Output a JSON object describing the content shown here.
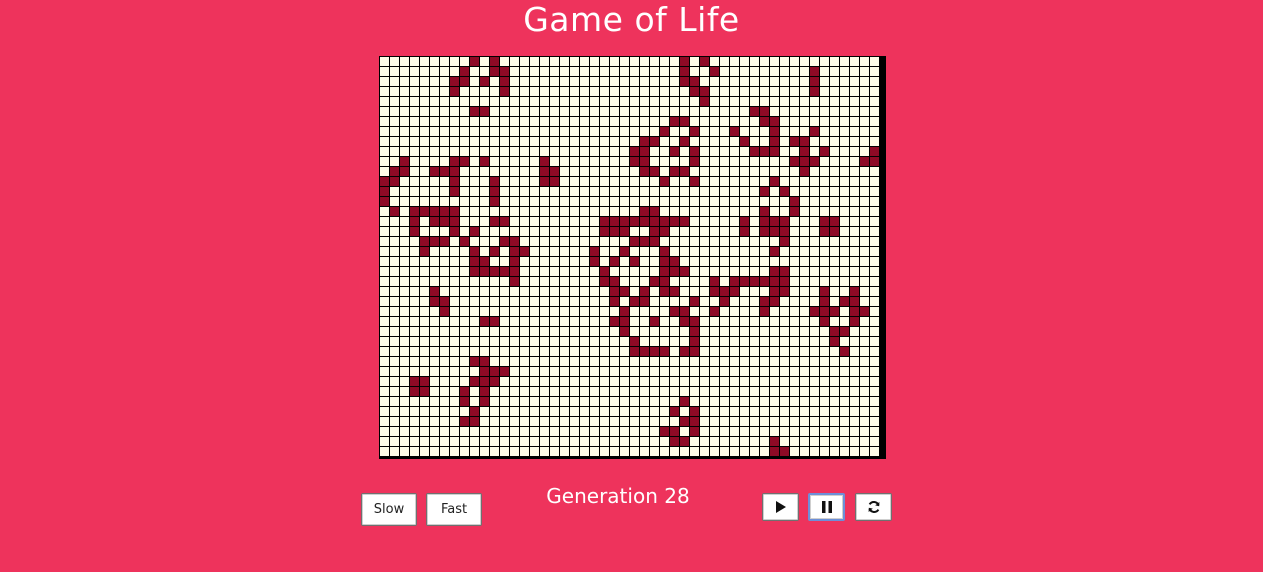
{
  "title": "Game of Life",
  "generation_label": "Generation 28",
  "controls": {
    "slow_label": "Slow",
    "fast_label": "Fast",
    "play_icon": "play-icon",
    "pause_icon": "pause-icon",
    "reset_icon": "refresh-icon"
  },
  "colors": {
    "background": "#ee335c",
    "cell_alive": "#8e0a25",
    "cell_dead": "#fffee8",
    "grid_line": "#000000"
  },
  "board": {
    "cols": 50,
    "rows": 40,
    "generation": 28,
    "live_cells": [
      [
        0,
        9
      ],
      [
        0,
        11
      ],
      [
        0,
        30
      ],
      [
        0,
        32
      ],
      [
        1,
        8
      ],
      [
        1,
        11
      ],
      [
        1,
        12
      ],
      [
        1,
        30
      ],
      [
        1,
        33
      ],
      [
        1,
        43
      ],
      [
        2,
        7
      ],
      [
        2,
        8
      ],
      [
        2,
        10
      ],
      [
        2,
        12
      ],
      [
        2,
        30
      ],
      [
        2,
        31
      ],
      [
        2,
        43
      ],
      [
        3,
        7
      ],
      [
        3,
        12
      ],
      [
        3,
        31
      ],
      [
        3,
        32
      ],
      [
        3,
        43
      ],
      [
        4,
        32
      ],
      [
        5,
        9
      ],
      [
        5,
        10
      ],
      [
        5,
        37
      ],
      [
        5,
        38
      ],
      [
        6,
        29
      ],
      [
        6,
        30
      ],
      [
        6,
        38
      ],
      [
        6,
        39
      ],
      [
        7,
        28
      ],
      [
        7,
        31
      ],
      [
        7,
        35
      ],
      [
        7,
        39
      ],
      [
        7,
        43
      ],
      [
        8,
        26
      ],
      [
        8,
        27
      ],
      [
        8,
        30
      ],
      [
        8,
        36
      ],
      [
        8,
        39
      ],
      [
        8,
        41
      ],
      [
        8,
        42
      ],
      [
        9,
        25
      ],
      [
        9,
        26
      ],
      [
        9,
        29
      ],
      [
        9,
        31
      ],
      [
        9,
        37
      ],
      [
        9,
        38
      ],
      [
        9,
        39
      ],
      [
        9,
        42
      ],
      [
        9,
        44
      ],
      [
        9,
        49
      ],
      [
        10,
        2
      ],
      [
        10,
        7
      ],
      [
        10,
        8
      ],
      [
        10,
        10
      ],
      [
        10,
        16
      ],
      [
        10,
        25
      ],
      [
        10,
        26
      ],
      [
        10,
        31
      ],
      [
        10,
        41
      ],
      [
        10,
        42
      ],
      [
        10,
        43
      ],
      [
        10,
        48
      ],
      [
        10,
        49
      ],
      [
        11,
        1
      ],
      [
        11,
        2
      ],
      [
        11,
        5
      ],
      [
        11,
        6
      ],
      [
        11,
        7
      ],
      [
        11,
        16
      ],
      [
        11,
        17
      ],
      [
        11,
        26
      ],
      [
        11,
        27
      ],
      [
        11,
        29
      ],
      [
        11,
        30
      ],
      [
        11,
        42
      ],
      [
        12,
        0
      ],
      [
        12,
        1
      ],
      [
        12,
        7
      ],
      [
        12,
        11
      ],
      [
        12,
        16
      ],
      [
        12,
        17
      ],
      [
        12,
        28
      ],
      [
        12,
        31
      ],
      [
        12,
        39
      ],
      [
        13,
        0
      ],
      [
        13,
        7
      ],
      [
        13,
        11
      ],
      [
        13,
        38
      ],
      [
        13,
        40
      ],
      [
        14,
        0
      ],
      [
        14,
        11
      ],
      [
        14,
        41
      ],
      [
        15,
        1
      ],
      [
        15,
        3
      ],
      [
        15,
        4
      ],
      [
        15,
        5
      ],
      [
        15,
        6
      ],
      [
        15,
        7
      ],
      [
        15,
        26
      ],
      [
        15,
        27
      ],
      [
        15,
        38
      ],
      [
        15,
        41
      ],
      [
        16,
        3
      ],
      [
        16,
        5
      ],
      [
        16,
        6
      ],
      [
        16,
        7
      ],
      [
        16,
        11
      ],
      [
        16,
        12
      ],
      [
        16,
        22
      ],
      [
        16,
        23
      ],
      [
        16,
        24
      ],
      [
        16,
        25
      ],
      [
        16,
        26
      ],
      [
        16,
        27
      ],
      [
        16,
        28
      ],
      [
        16,
        29
      ],
      [
        16,
        30
      ],
      [
        16,
        36
      ],
      [
        16,
        38
      ],
      [
        16,
        39
      ],
      [
        16,
        40
      ],
      [
        16,
        44
      ],
      [
        16,
        45
      ],
      [
        17,
        3
      ],
      [
        17,
        7
      ],
      [
        17,
        9
      ],
      [
        17,
        22
      ],
      [
        17,
        23
      ],
      [
        17,
        24
      ],
      [
        17,
        27
      ],
      [
        17,
        28
      ],
      [
        17,
        36
      ],
      [
        17,
        38
      ],
      [
        17,
        39
      ],
      [
        17,
        40
      ],
      [
        17,
        44
      ],
      [
        17,
        45
      ],
      [
        18,
        4
      ],
      [
        18,
        5
      ],
      [
        18,
        6
      ],
      [
        18,
        8
      ],
      [
        18,
        12
      ],
      [
        18,
        13
      ],
      [
        18,
        25
      ],
      [
        18,
        26
      ],
      [
        18,
        27
      ],
      [
        18,
        40
      ],
      [
        19,
        4
      ],
      [
        19,
        9
      ],
      [
        19,
        11
      ],
      [
        19,
        13
      ],
      [
        19,
        14
      ],
      [
        19,
        21
      ],
      [
        19,
        24
      ],
      [
        19,
        28
      ],
      [
        19,
        39
      ],
      [
        20,
        9
      ],
      [
        20,
        10
      ],
      [
        20,
        13
      ],
      [
        20,
        21
      ],
      [
        20,
        23
      ],
      [
        20,
        25
      ],
      [
        20,
        28
      ],
      [
        20,
        29
      ],
      [
        21,
        9
      ],
      [
        21,
        10
      ],
      [
        21,
        11
      ],
      [
        21,
        12
      ],
      [
        21,
        13
      ],
      [
        21,
        22
      ],
      [
        21,
        28
      ],
      [
        21,
        29
      ],
      [
        21,
        30
      ],
      [
        21,
        39
      ],
      [
        21,
        40
      ],
      [
        22,
        13
      ],
      [
        22,
        22
      ],
      [
        22,
        23
      ],
      [
        22,
        27
      ],
      [
        22,
        28
      ],
      [
        22,
        33
      ],
      [
        22,
        35
      ],
      [
        22,
        36
      ],
      [
        22,
        37
      ],
      [
        22,
        38
      ],
      [
        22,
        39
      ],
      [
        22,
        40
      ],
      [
        23,
        5
      ],
      [
        23,
        23
      ],
      [
        23,
        24
      ],
      [
        23,
        26
      ],
      [
        23,
        28
      ],
      [
        23,
        29
      ],
      [
        23,
        33
      ],
      [
        23,
        34
      ],
      [
        23,
        35
      ],
      [
        23,
        39
      ],
      [
        23,
        40
      ],
      [
        23,
        44
      ],
      [
        23,
        47
      ],
      [
        24,
        5
      ],
      [
        24,
        6
      ],
      [
        24,
        23
      ],
      [
        24,
        25
      ],
      [
        24,
        26
      ],
      [
        24,
        31
      ],
      [
        24,
        34
      ],
      [
        24,
        38
      ],
      [
        24,
        39
      ],
      [
        24,
        44
      ],
      [
        24,
        46
      ],
      [
        24,
        47
      ],
      [
        25,
        6
      ],
      [
        25,
        24
      ],
      [
        25,
        29
      ],
      [
        25,
        30
      ],
      [
        25,
        33
      ],
      [
        25,
        38
      ],
      [
        25,
        43
      ],
      [
        25,
        44
      ],
      [
        25,
        45
      ],
      [
        25,
        47
      ],
      [
        25,
        48
      ],
      [
        26,
        10
      ],
      [
        26,
        11
      ],
      [
        26,
        23
      ],
      [
        26,
        24
      ],
      [
        26,
        27
      ],
      [
        26,
        30
      ],
      [
        26,
        31
      ],
      [
        26,
        44
      ],
      [
        26,
        47
      ],
      [
        27,
        24
      ],
      [
        27,
        31
      ],
      [
        27,
        45
      ],
      [
        27,
        46
      ],
      [
        28,
        25
      ],
      [
        28,
        31
      ],
      [
        28,
        45
      ],
      [
        29,
        25
      ],
      [
        29,
        26
      ],
      [
        29,
        27
      ],
      [
        29,
        28
      ],
      [
        29,
        30
      ],
      [
        29,
        31
      ],
      [
        29,
        46
      ],
      [
        30,
        9
      ],
      [
        30,
        10
      ],
      [
        31,
        10
      ],
      [
        31,
        11
      ],
      [
        31,
        12
      ],
      [
        32,
        3
      ],
      [
        32,
        4
      ],
      [
        32,
        9
      ],
      [
        32,
        10
      ],
      [
        32,
        11
      ],
      [
        33,
        3
      ],
      [
        33,
        4
      ],
      [
        33,
        8
      ],
      [
        33,
        10
      ],
      [
        34,
        8
      ],
      [
        34,
        10
      ],
      [
        34,
        30
      ],
      [
        35,
        9
      ],
      [
        35,
        29
      ],
      [
        35,
        31
      ],
      [
        36,
        8
      ],
      [
        36,
        9
      ],
      [
        36,
        30
      ],
      [
        36,
        31
      ],
      [
        37,
        28
      ],
      [
        37,
        29
      ],
      [
        37,
        31
      ],
      [
        38,
        29
      ],
      [
        38,
        30
      ],
      [
        38,
        39
      ],
      [
        39,
        39
      ],
      [
        39,
        40
      ]
    ]
  }
}
